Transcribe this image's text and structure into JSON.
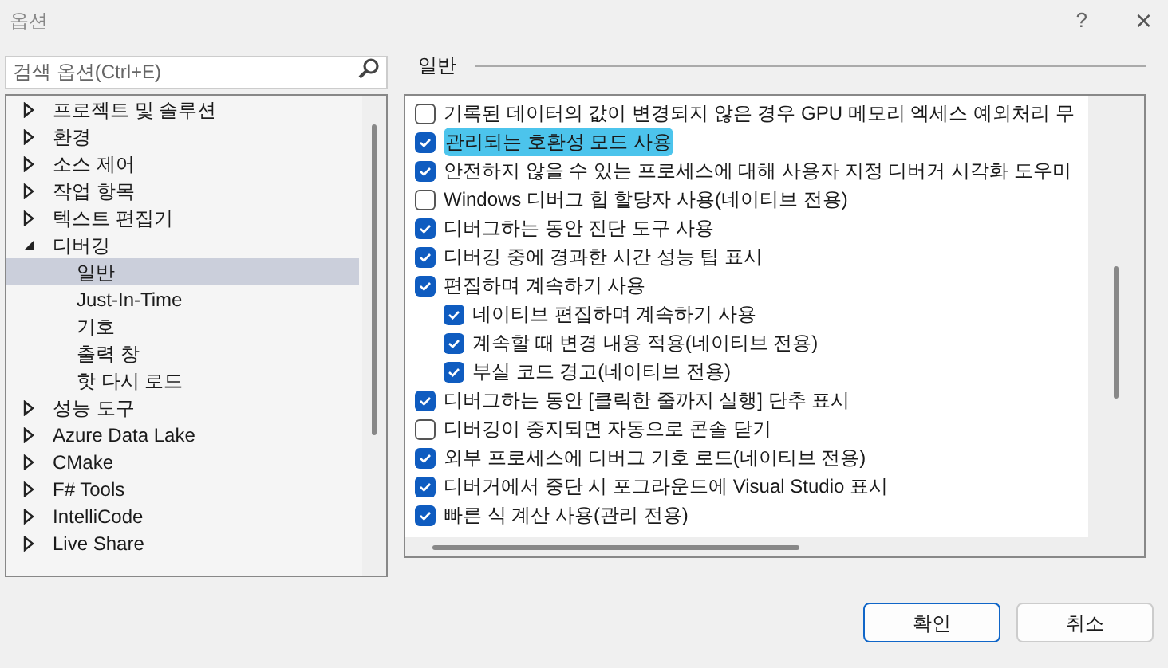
{
  "window": {
    "title": "옵션",
    "help": "?",
    "close": "×"
  },
  "search": {
    "placeholder": "검색 옵션(Ctrl+E)"
  },
  "tree": [
    {
      "label": "프로젝트 및 솔루션",
      "expanded": false,
      "selected": false
    },
    {
      "label": "환경",
      "expanded": false,
      "selected": false
    },
    {
      "label": "소스 제어",
      "expanded": false,
      "selected": false
    },
    {
      "label": "작업 항목",
      "expanded": false,
      "selected": false
    },
    {
      "label": "텍스트 편집기",
      "expanded": false,
      "selected": false
    },
    {
      "label": "디버깅",
      "expanded": true,
      "selected": false,
      "children": [
        {
          "label": "일반",
          "selected": true
        },
        {
          "label": "Just-In-Time",
          "selected": false
        },
        {
          "label": "기호",
          "selected": false
        },
        {
          "label": "출력 창",
          "selected": false
        },
        {
          "label": "핫 다시 로드",
          "selected": false
        }
      ]
    },
    {
      "label": "성능 도구",
      "expanded": false,
      "selected": false
    },
    {
      "label": "Azure Data Lake",
      "expanded": false,
      "selected": false
    },
    {
      "label": "CMake",
      "expanded": false,
      "selected": false
    },
    {
      "label": "F# Tools",
      "expanded": false,
      "selected": false
    },
    {
      "label": "IntelliCode",
      "expanded": false,
      "selected": false
    },
    {
      "label": "Live Share",
      "expanded": false,
      "selected": false
    }
  ],
  "section": {
    "title": "일반"
  },
  "options": [
    {
      "label": "기록된 데이터의 값이 변경되지 않은 경우 GPU 메모리 엑세스 예외처리 무",
      "checked": false,
      "highlighted": false
    },
    {
      "label": "관리되는 호환성 모드 사용",
      "checked": true,
      "highlighted": true
    },
    {
      "label": "안전하지 않을 수 있는 프로세스에 대해 사용자 지정 디버거 시각화 도우미",
      "checked": true,
      "highlighted": false
    },
    {
      "label": "Windows 디버그 힙 할당자 사용(네이티브 전용)",
      "checked": false,
      "highlighted": false
    },
    {
      "label": "디버그하는 동안 진단 도구 사용",
      "checked": true,
      "highlighted": false
    },
    {
      "label": "디버깅 중에 경과한 시간 성능 팁 표시",
      "checked": true,
      "highlighted": false
    },
    {
      "label": "편집하며 계속하기 사용",
      "checked": true,
      "highlighted": false,
      "children": [
        {
          "label": "네이티브 편집하며 계속하기 사용",
          "checked": true,
          "highlighted": false
        },
        {
          "label": "계속할 때 변경 내용 적용(네이티브 전용)",
          "checked": true,
          "highlighted": false
        },
        {
          "label": "부실 코드 경고(네이티브 전용)",
          "checked": true,
          "highlighted": false
        }
      ]
    },
    {
      "label": "디버그하는 동안 [클릭한 줄까지 실행] 단추 표시",
      "checked": true,
      "highlighted": false
    },
    {
      "label": "디버깅이 중지되면 자동으로 콘솔 닫기",
      "checked": false,
      "highlighted": false
    },
    {
      "label": "외부 프로세스에 디버그 기호 로드(네이티브 전용)",
      "checked": true,
      "highlighted": false
    },
    {
      "label": "디버거에서 중단 시 포그라운드에 Visual Studio 표시",
      "checked": true,
      "highlighted": false
    },
    {
      "label": "빠른 식 계산 사용(관리 전용)",
      "checked": true,
      "highlighted": false
    }
  ],
  "buttons": [
    {
      "label": "확인",
      "kind": "primary"
    },
    {
      "label": "취소",
      "kind": "secondary"
    }
  ]
}
